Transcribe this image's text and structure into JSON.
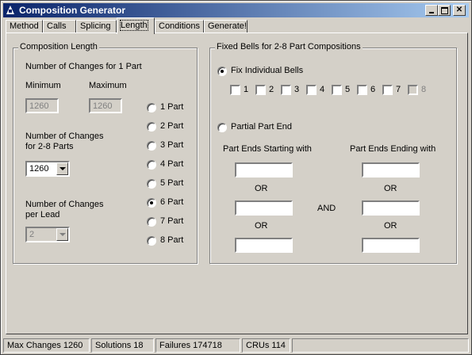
{
  "window": {
    "title": "Composition Generator"
  },
  "tabs": [
    {
      "label": "Method"
    },
    {
      "label": "Calls"
    },
    {
      "label": "Splicing"
    },
    {
      "label": "Length"
    },
    {
      "label": "Conditions"
    },
    {
      "label": "Generate!"
    }
  ],
  "active_tab": "Length",
  "composition_length": {
    "group_title": "Composition Length",
    "changes_1_part_label": "Number of Changes for 1 Part",
    "minimum_label": "Minimum",
    "maximum_label": "Maximum",
    "minimum_value": "1260",
    "maximum_value": "1260",
    "changes_2_8_label_line1": "Number of Changes",
    "changes_2_8_label_line2": "for 2-8 Parts",
    "changes_2_8_value": "1260",
    "changes_per_lead_label_line1": "Number of Changes",
    "changes_per_lead_label_line2": "per Lead",
    "changes_per_lead_value": "2",
    "parts": [
      {
        "label": "1 Part",
        "checked": false
      },
      {
        "label": "2 Part",
        "checked": false
      },
      {
        "label": "3 Part",
        "checked": false
      },
      {
        "label": "4 Part",
        "checked": false
      },
      {
        "label": "5 Part",
        "checked": false
      },
      {
        "label": "6 Part",
        "checked": true
      },
      {
        "label": "7 Part",
        "checked": false
      },
      {
        "label": "8 Part",
        "checked": false
      }
    ]
  },
  "fixed_bells": {
    "group_title": "Fixed Bells for 2-8 Part Compositions",
    "fix_individual_label": "Fix Individual Bells",
    "bells": [
      "1",
      "2",
      "3",
      "4",
      "5",
      "6",
      "7",
      "8"
    ],
    "partial_part_end_label": "Partial Part End",
    "starting_with_label": "Part Ends Starting with",
    "ending_with_label": "Part Ends Ending with",
    "or_label": "OR",
    "and_label": "AND"
  },
  "status": {
    "max_changes": "Max Changes 1260",
    "solutions": "Solutions 18",
    "failures": "Failures  174718",
    "crus": "CRUs 114"
  }
}
